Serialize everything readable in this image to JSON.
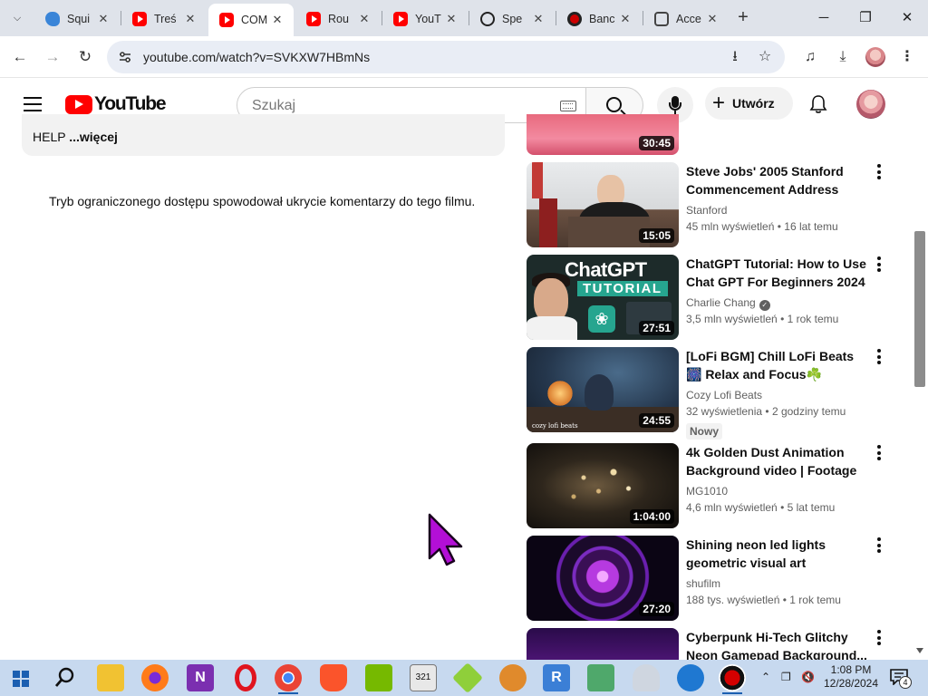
{
  "browser": {
    "tabs": [
      {
        "title": "Squi",
        "favicon": "squirrel-icon",
        "active": false
      },
      {
        "title": "Treś",
        "favicon": "youtube-icon",
        "active": false
      },
      {
        "title": "COM",
        "favicon": "youtube-icon",
        "active": true
      },
      {
        "title": "Rou",
        "favicon": "youtube-icon",
        "active": false
      },
      {
        "title": "YouT",
        "favicon": "youtube-icon",
        "active": false
      },
      {
        "title": "Spe",
        "favicon": "speedtest-icon",
        "active": false
      },
      {
        "title": "Banc",
        "favicon": "record-icon",
        "active": false
      },
      {
        "title": "Acce",
        "favicon": "accessibility-icon",
        "active": false
      }
    ],
    "url": "youtube.com/watch?v=SVKXW7HBmNs",
    "accent": "#ff0000"
  },
  "youtube": {
    "logo_text": "YouTube",
    "search_placeholder": "Szukaj",
    "create_label": "Utwórz"
  },
  "description": {
    "text": "HELP",
    "more_label": "...więcej"
  },
  "comments_disabled_note": "Tryb ograniczonego dostępu spowodował ukrycie komentarzy do tego filmu.",
  "recommendations": [
    {
      "title": "",
      "channel": "",
      "stats": "",
      "duration": "30:45",
      "new": ""
    },
    {
      "title": "Steve Jobs' 2005 Stanford Commencement Address",
      "channel": "Stanford",
      "verified": false,
      "views": "45 mln wyświetleń",
      "age": "16 lat temu",
      "duration": "15:05",
      "new": ""
    },
    {
      "title": "ChatGPT Tutorial: How to Use Chat GPT For Beginners 2024",
      "channel": "Charlie Chang",
      "verified": true,
      "views": "3,5 mln wyświetleń",
      "age": "1 rok temu",
      "duration": "27:51",
      "new": "",
      "thumb_text": "ChatGPT",
      "thumb_badge": "TUTORIAL"
    },
    {
      "title": "[LoFi BGM] Chill LoFi Beats 🎆 Relax and Focus☘️",
      "channel": "Cozy Lofi Beats",
      "verified": false,
      "views": "32 wyświetlenia",
      "age": "2 godziny temu",
      "duration": "24:55",
      "new": "Nowy",
      "thumb_caption": "cozy lofi beats"
    },
    {
      "title": "4k Golden Dust Animation Background video | Footage |...",
      "channel": "MG1010",
      "verified": false,
      "views": "4,6 mln wyświetleń",
      "age": "5 lat temu",
      "duration": "1:04:00",
      "new": ""
    },
    {
      "title": "Shining neon led lights geometric visual art",
      "channel": "shufilm",
      "verified": false,
      "views": "188 tys. wyświetleń",
      "age": "1 rok temu",
      "duration": "27:20",
      "new": ""
    },
    {
      "title": "Cyberpunk Hi-Tech Glitchy Neon Gamepad Background...",
      "channel": "",
      "verified": false,
      "views": "",
      "age": "",
      "duration": "",
      "new": ""
    }
  ],
  "taskbar": {
    "apps": [
      "search-icon",
      "file-explorer-icon",
      "firefox-icon",
      "onenote-icon",
      "opera-icon",
      "chrome-icon",
      "brave-icon",
      "nvidia-icon",
      "calendar-321-icon",
      "green-app-icon",
      "squirrel-icon",
      "r-app-icon",
      "network-tool-icon",
      "ghost-icon",
      "security-icon",
      "record-icon"
    ],
    "time": "1:08 PM",
    "date": "12/28/2024",
    "notifications": "4"
  }
}
